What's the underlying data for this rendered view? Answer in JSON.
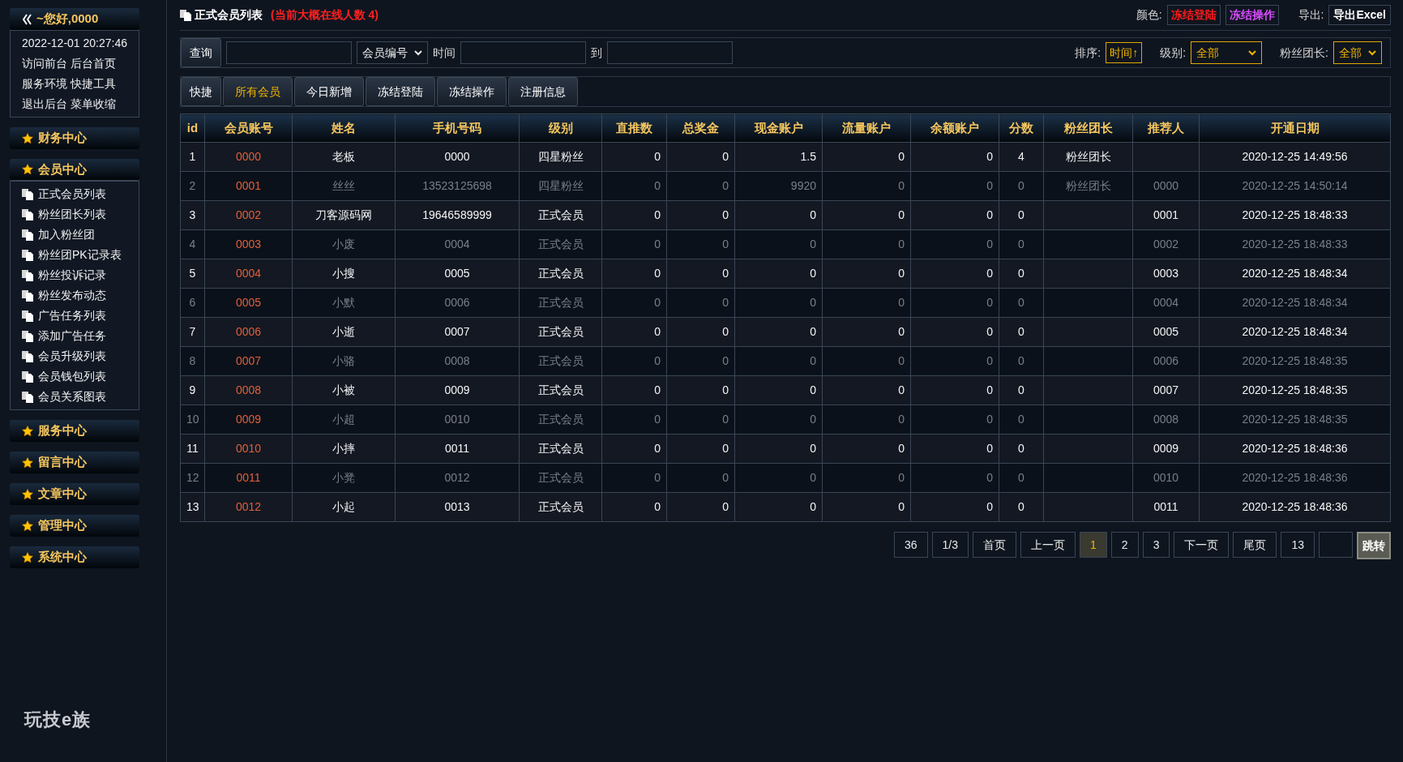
{
  "sidebar": {
    "greeting": "~您好,0000",
    "info": {
      "datetime": "2022-12-01 20:27:46",
      "links": [
        [
          "访问前台",
          "后台首页"
        ],
        [
          "服务环境",
          "快捷工具"
        ],
        [
          "退出后台",
          "菜单收缩"
        ]
      ]
    },
    "sections": [
      {
        "title": "财务中心",
        "expanded": false
      },
      {
        "title": "会员中心",
        "expanded": true,
        "items": [
          "正式会员列表",
          "粉丝团长列表",
          "加入粉丝团",
          "粉丝团PK记录表",
          "粉丝投诉记录",
          "粉丝发布动态",
          "广告任务列表",
          "添加广告任务",
          "会员升级列表",
          "会员钱包列表",
          "会员关系图表"
        ]
      },
      {
        "title": "服务中心",
        "expanded": false
      },
      {
        "title": "留言中心",
        "expanded": false
      },
      {
        "title": "文章中心",
        "expanded": false
      },
      {
        "title": "管理中心",
        "expanded": false
      },
      {
        "title": "系统中心",
        "expanded": false
      }
    ],
    "logo": "玩技e族"
  },
  "header": {
    "title": "正式会员列表",
    "note": "(当前大概在线人数 4)",
    "color_label": "颜色:",
    "legend": [
      {
        "text": "冻结登陆",
        "color": "#ff1a1a"
      },
      {
        "text": "冻结操作",
        "color": "#d94dff"
      }
    ],
    "export_label": "导出:",
    "export_button": "导出Excel"
  },
  "search": {
    "button": "查询",
    "field_select": "会员编号",
    "time_label": "时间",
    "to_label": "到",
    "sort_label": "排序:",
    "sort_button": "时间↑",
    "level_label": "级别:",
    "level_select": "全部",
    "leader_label": "粉丝团长:",
    "leader_select": "全部"
  },
  "tabs": [
    {
      "label": "快捷",
      "selected": false
    },
    {
      "label": "所有会员",
      "selected": true
    },
    {
      "label": "今日新增",
      "selected": false
    },
    {
      "label": "冻结登陆",
      "selected": false
    },
    {
      "label": "冻结操作",
      "selected": false
    },
    {
      "label": "注册信息",
      "selected": false
    }
  ],
  "table": {
    "columns": [
      "id",
      "会员账号",
      "姓名",
      "手机号码",
      "级别",
      "直推数",
      "总奖金",
      "现金账户",
      "流量账户",
      "余额账户",
      "分数",
      "粉丝团长",
      "推荐人",
      "开通日期"
    ],
    "rows": [
      [
        "1",
        "0000",
        "老板",
        "0000",
        "四星粉丝",
        "0",
        "0",
        "1.5",
        "0",
        "0",
        "4",
        "粉丝团长",
        "",
        "2020-12-25 14:49:56"
      ],
      [
        "2",
        "0001",
        "丝丝",
        "13523125698",
        "四星粉丝",
        "0",
        "0",
        "9920",
        "0",
        "0",
        "0",
        "粉丝团长",
        "0000",
        "2020-12-25 14:50:14"
      ],
      [
        "3",
        "0002",
        "刀客源码网",
        "19646589999",
        "正式会员",
        "0",
        "0",
        "0",
        "0",
        "0",
        "0",
        "",
        "0001",
        "2020-12-25 18:48:33"
      ],
      [
        "4",
        "0003",
        "小废",
        "0004",
        "正式会员",
        "0",
        "0",
        "0",
        "0",
        "0",
        "0",
        "",
        "0002",
        "2020-12-25 18:48:33"
      ],
      [
        "5",
        "0004",
        "小搜",
        "0005",
        "正式会员",
        "0",
        "0",
        "0",
        "0",
        "0",
        "0",
        "",
        "0003",
        "2020-12-25 18:48:34"
      ],
      [
        "6",
        "0005",
        "小默",
        "0006",
        "正式会员",
        "0",
        "0",
        "0",
        "0",
        "0",
        "0",
        "",
        "0004",
        "2020-12-25 18:48:34"
      ],
      [
        "7",
        "0006",
        "小逝",
        "0007",
        "正式会员",
        "0",
        "0",
        "0",
        "0",
        "0",
        "0",
        "",
        "0005",
        "2020-12-25 18:48:34"
      ],
      [
        "8",
        "0007",
        "小骆",
        "0008",
        "正式会员",
        "0",
        "0",
        "0",
        "0",
        "0",
        "0",
        "",
        "0006",
        "2020-12-25 18:48:35"
      ],
      [
        "9",
        "0008",
        "小被",
        "0009",
        "正式会员",
        "0",
        "0",
        "0",
        "0",
        "0",
        "0",
        "",
        "0007",
        "2020-12-25 18:48:35"
      ],
      [
        "10",
        "0009",
        "小超",
        "0010",
        "正式会员",
        "0",
        "0",
        "0",
        "0",
        "0",
        "0",
        "",
        "0008",
        "2020-12-25 18:48:35"
      ],
      [
        "11",
        "0010",
        "小摔",
        "0011",
        "正式会员",
        "0",
        "0",
        "0",
        "0",
        "0",
        "0",
        "",
        "0009",
        "2020-12-25 18:48:36"
      ],
      [
        "12",
        "0011",
        "小凳",
        "0012",
        "正式会员",
        "0",
        "0",
        "0",
        "0",
        "0",
        "0",
        "",
        "0010",
        "2020-12-25 18:48:36"
      ],
      [
        "13",
        "0012",
        "小起",
        "0013",
        "正式会员",
        "0",
        "0",
        "0",
        "0",
        "0",
        "0",
        "",
        "0011",
        "2020-12-25 18:48:36"
      ]
    ]
  },
  "pagination": [
    {
      "kind": "info",
      "label": "36"
    },
    {
      "kind": "info",
      "label": "1/3"
    },
    {
      "kind": "link",
      "label": "首页"
    },
    {
      "kind": "link",
      "label": "上一页"
    },
    {
      "kind": "page",
      "label": "1",
      "selected": true
    },
    {
      "kind": "page",
      "label": "2",
      "selected": false
    },
    {
      "kind": "page",
      "label": "3",
      "selected": false
    },
    {
      "kind": "link",
      "label": "下一页"
    },
    {
      "kind": "link",
      "label": "尾页"
    },
    {
      "kind": "info",
      "label": "13"
    },
    {
      "kind": "input"
    },
    {
      "kind": "button",
      "label": "跳转"
    }
  ]
}
